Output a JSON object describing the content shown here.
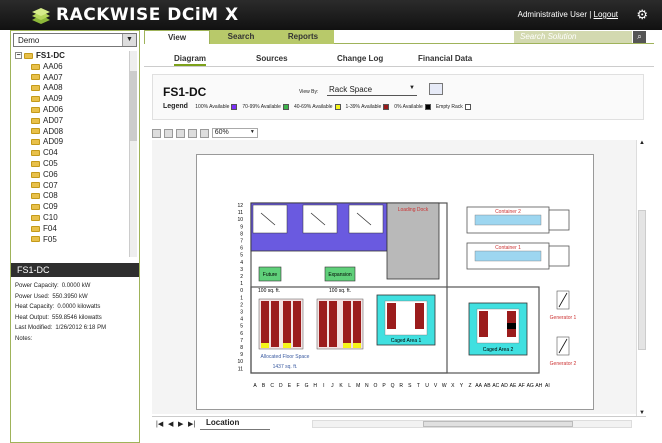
{
  "app": {
    "brand": "RACKWISE DCiM X",
    "user_text": "Administrative User",
    "separator": "|",
    "logout_label": "Logout"
  },
  "left": {
    "site_select": "Demo",
    "tree": [
      {
        "label": "FS1-DC",
        "root": true
      },
      {
        "label": "AA06"
      },
      {
        "label": "AA07"
      },
      {
        "label": "AA08"
      },
      {
        "label": "AA09"
      },
      {
        "label": "AD06"
      },
      {
        "label": "AD07"
      },
      {
        "label": "AD08"
      },
      {
        "label": "AD09"
      },
      {
        "label": "C04"
      },
      {
        "label": "C05"
      },
      {
        "label": "C06"
      },
      {
        "label": "C07"
      },
      {
        "label": "C08"
      },
      {
        "label": "C09"
      },
      {
        "label": "C10"
      },
      {
        "label": "F04"
      },
      {
        "label": "F05"
      }
    ],
    "info_title": "FS1-DC",
    "info": [
      {
        "label": "Power Capacity:",
        "value": "0.0000 kW"
      },
      {
        "label": "Power Used:",
        "value": "550.3950 kW"
      },
      {
        "label": "Heat Capacity:",
        "value": "0.0000 kilowatts"
      },
      {
        "label": "Heat Output:",
        "value": "559.8546 kilowatts"
      },
      {
        "label": "Last Modified:",
        "value": "1/26/2012 6:18 PM"
      },
      {
        "label": "Notes:",
        "value": ""
      }
    ]
  },
  "tabs": {
    "view": "View",
    "search": "Search",
    "reports": "Reports",
    "search_placeholder": "Search Solution"
  },
  "subtabs": {
    "diagram": "Diagram",
    "sources": "Sources",
    "change_log": "Change Log",
    "financial_data": "Financial Data"
  },
  "header": {
    "title": "FS1-DC",
    "view_by_label": "View By:",
    "view_by_value": "Rack Space",
    "legend_label": "Legend",
    "legend": [
      {
        "label": "100% Available",
        "color": "#7b2ff7"
      },
      {
        "label": "70-99% Available",
        "color": "#3cb44b"
      },
      {
        "label": "40-69% Available",
        "color": "#f5f51a"
      },
      {
        "label": "1-39% Available",
        "color": "#9b1c1c"
      },
      {
        "label": "0% Available",
        "color": "#000000"
      },
      {
        "label": "Empty Rack",
        "color": "#ffffff"
      }
    ]
  },
  "zoom": {
    "value": "60%"
  },
  "floorplan": {
    "room_labels": {
      "loading_dock": "Loading Dock",
      "container_1": "Container 1",
      "container_2": "Container 2",
      "future": "Future",
      "expansion": "Expansion",
      "future_size": "100 sq. ft.",
      "expansion_size": "100 sq. ft.",
      "allocated": "Allocated Floor Space",
      "allocated_size": "1437 sq. ft.",
      "caged_area_1": "Caged Area 1",
      "caged_area_2": "Caged Area 2",
      "generator_1": "Generator 1",
      "generator_2": "Generator 2"
    },
    "row_numbers": [
      "12",
      "11",
      "10",
      "9",
      "8",
      "7",
      "6",
      "5",
      "4",
      "3",
      "2",
      "1",
      "0",
      "1",
      "2",
      "3",
      "4",
      "5",
      "6",
      "7",
      "8",
      "9",
      "10",
      "11"
    ],
    "col_letters": [
      "A",
      "B",
      "C",
      "D",
      "E",
      "F",
      "G",
      "H",
      "I",
      "J",
      "K",
      "L",
      "M",
      "N",
      "O",
      "P",
      "Q",
      "R",
      "S",
      "T",
      "U",
      "V",
      "W",
      "X",
      "Y",
      "Z",
      "AA",
      "AB",
      "AC",
      "AD",
      "AE",
      "AF",
      "AG",
      "AH",
      "AI"
    ]
  },
  "bottom": {
    "location_tab": "Location"
  },
  "colors": {
    "accent": "#9fb35a",
    "topbar": "#1a1a1a",
    "room_blue": "#6a5ae0",
    "cage_cyan": "#40e0e0",
    "rack_red": "#9b1c1c"
  }
}
